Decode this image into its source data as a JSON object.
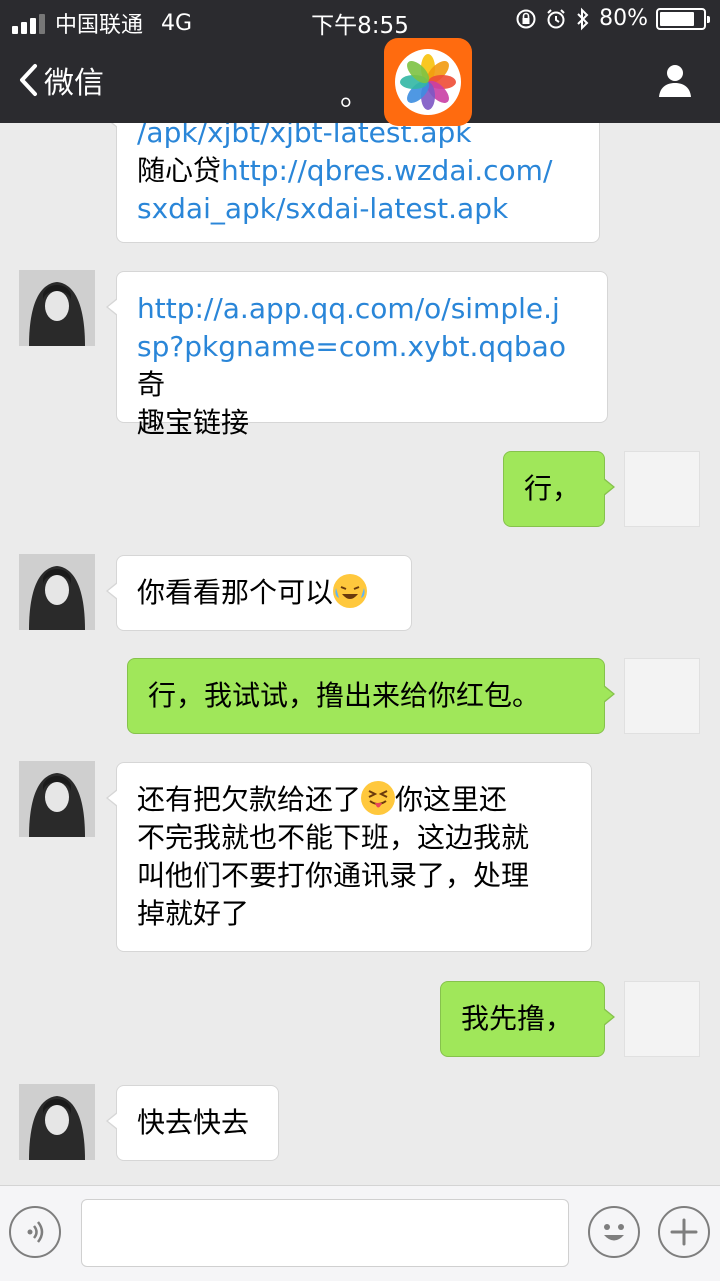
{
  "status_bar": {
    "carrier": "中国联通",
    "network": "4G",
    "time": "下午8:55",
    "battery": "80%",
    "battery_level": 0.8
  },
  "nav": {
    "back_label": "微信",
    "title": "。"
  },
  "messages": [
    {
      "side": "in",
      "parts": [
        {
          "t": "/apk/xjbt/xjbt-latest.apk",
          "link": true
        },
        {
          "t": "随心贷"
        },
        {
          "t": "http://qbres.wzdai.com/",
          "link": true
        },
        {
          "t": "sxdai_apk/sxdai-latest.apk",
          "link": true
        }
      ]
    },
    {
      "side": "in",
      "parts": [
        {
          "t": "http://a.app.qq.com/o/simple.j",
          "link": true
        },
        {
          "t": "sp?pkgname=com.xybt.qqbao",
          "link": true
        },
        {
          "t": "奇"
        },
        {
          "t": "趣宝链接"
        }
      ]
    },
    {
      "side": "out",
      "text": "行，"
    },
    {
      "side": "in",
      "text": "你看看那个可以",
      "emoji": "crying-laughing-emoji"
    },
    {
      "side": "out",
      "text": "行，我试试，撸出来给你红包。"
    },
    {
      "side": "in",
      "parts": [
        {
          "t": "还有把欠款给还了"
        },
        {
          "t": "你这里还"
        },
        {
          "t": "不完我就也不能下班，这边我就"
        },
        {
          "t": "叫他们不要打你通讯录了，处理"
        },
        {
          "t": "掉就好了"
        }
      ],
      "emoji": "tongue-out-emoji"
    },
    {
      "side": "out",
      "text": "我先撸，"
    },
    {
      "side": "in",
      "text": "快去快去"
    }
  ],
  "colors": {
    "header_bg": "#2b2b2f",
    "chat_bg": "#ebebeb",
    "out_bubble": "#a0e75a",
    "link": "#2a86d8",
    "app_icon_bg": "#ff6b0f"
  }
}
